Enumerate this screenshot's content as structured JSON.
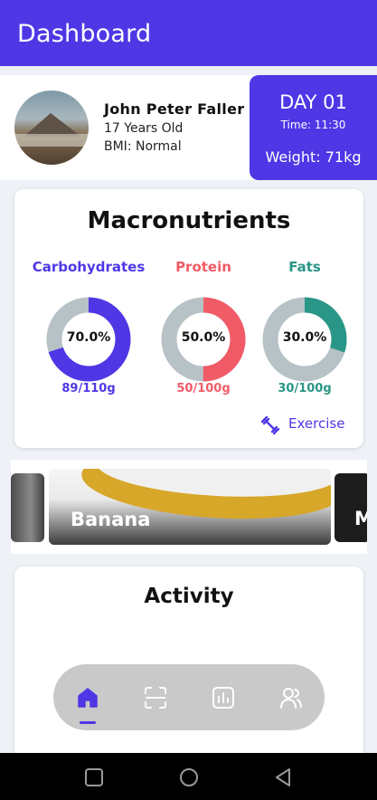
{
  "app_bar": {
    "title": "Dashboard"
  },
  "profile": {
    "name": "John Peter Faller",
    "age": "17 Years Old",
    "bmi": "BMI: Normal"
  },
  "day_card": {
    "day": "DAY 01",
    "time": "Time: 11:30",
    "weight": "Weight: 71kg"
  },
  "macronutrients": {
    "title": "Macronutrients",
    "items": [
      {
        "label": "Carbohydrates",
        "percent_text": "70.0%",
        "percent": 70,
        "grams": "89/110g",
        "color": "#4f37e6"
      },
      {
        "label": "Protein",
        "percent_text": "50.0%",
        "percent": 50,
        "grams": "50/100g",
        "color": "#f15b67"
      },
      {
        "label": "Fats",
        "percent_text": "30.0%",
        "percent": 30,
        "grams": "30/100g",
        "color": "#2a9687"
      }
    ],
    "exercise_label": "Exercise"
  },
  "carousel": {
    "items": [
      {
        "name": ""
      },
      {
        "name": "Banana"
      },
      {
        "name": "M"
      }
    ]
  },
  "activity": {
    "title": "Activity"
  },
  "bottom_nav": {
    "items": [
      {
        "icon": "home-icon",
        "active": true
      },
      {
        "icon": "scan-icon",
        "active": false
      },
      {
        "icon": "chart-icon",
        "active": false
      },
      {
        "icon": "users-icon",
        "active": false
      }
    ]
  },
  "system_nav": {
    "icons": [
      "recents-icon",
      "home-circle-icon",
      "back-icon"
    ]
  },
  "colors": {
    "primary": "#4f37e6",
    "ring_track": "#b6c2c6",
    "protein": "#f15b67",
    "fats": "#2a9687"
  }
}
